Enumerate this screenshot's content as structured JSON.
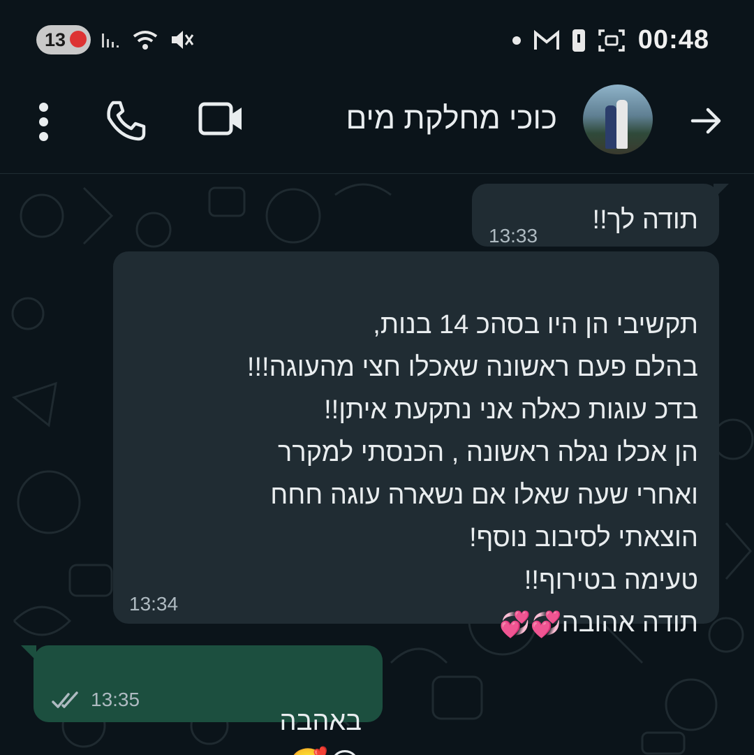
{
  "status_bar": {
    "notification_count": "13",
    "time": "00:48"
  },
  "header": {
    "contact_name": "כוכי מחלקת מים"
  },
  "messages": [
    {
      "direction": "incoming",
      "text": "תודה לך!!",
      "time": "13:33"
    },
    {
      "direction": "incoming",
      "text": "תקשיבי הן היו בסהכ 14 בנות,\nבהלם פעם ראשונה שאכלו חצי מהעוגה!!!\nבדכ עוגות כאלה אני נתקעת איתן!!\nהן אכלו נגלה ראשונה , הכנסתי למקרר\nואחרי שעה שאלו אם נשארה עוגה חחח\nהוצאתי לסיבוב נוסף!\nטעימה בטירוף!!\nתודה אהובה",
      "emojis": [
        "💞",
        "💞"
      ],
      "time": "13:34"
    },
    {
      "direction": "outgoing",
      "text": "באהבה",
      "emojis": [
        "😊",
        "🥰"
      ],
      "time": "13:35",
      "status": "delivered-double-check"
    }
  ],
  "colors": {
    "background": "#0b141a",
    "incoming_bubble": "#202c33",
    "outgoing_bubble": "#1c4f3f",
    "meta_text": "#aebac1"
  }
}
